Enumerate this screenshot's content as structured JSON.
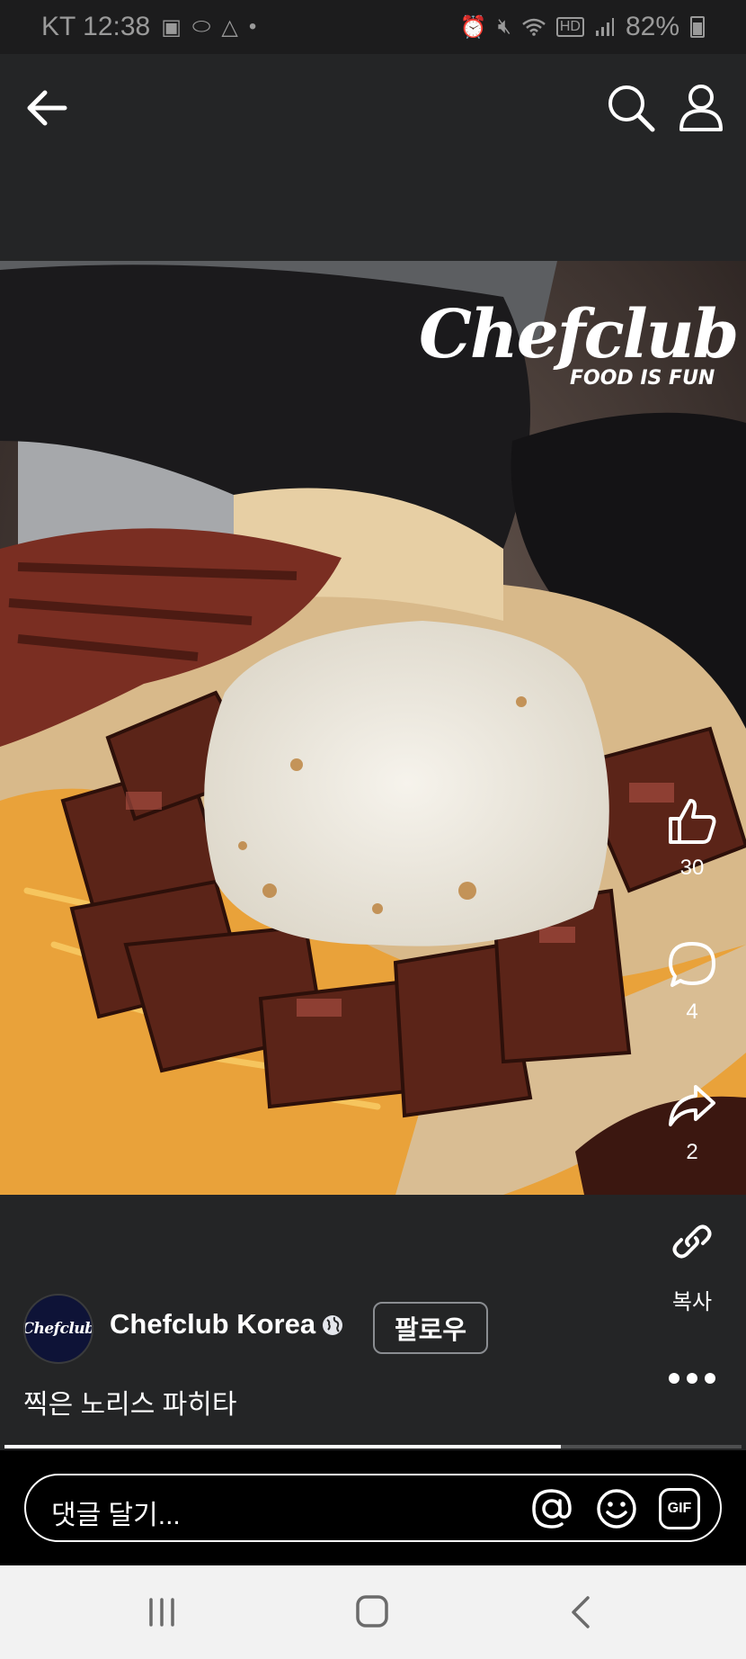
{
  "status_bar": {
    "carrier_time": "KT 12:38",
    "battery_percent": "82%",
    "left_icons": [
      "screenshot-icon",
      "pill-icon",
      "warning-icon",
      "dot-icon"
    ],
    "right_icons": [
      "alarm-icon",
      "mute-icon",
      "wifi-icon",
      "hd-icon",
      "signal-icon",
      "battery-icon"
    ]
  },
  "app_bar": {
    "back_icon": "back-arrow-icon",
    "search_icon": "search-icon",
    "profile_icon": "profile-icon"
  },
  "video": {
    "watermark_brand": "Chefclub",
    "watermark_tagline": "FOOD IS FUN",
    "progress": 0.755
  },
  "actions": {
    "like_count": "30",
    "comment_count": "4",
    "share_count": "2",
    "copy_label": "복사"
  },
  "post": {
    "avatar_text": "Chefclub",
    "page_name": "Chefclub Korea",
    "follow_label": "팔로우",
    "caption": "찍은 노리스 파히타"
  },
  "comment_bar": {
    "placeholder": "댓글 달기...",
    "gif_label": "GIF"
  },
  "colors": {
    "background": "#242526",
    "comment_bar": "#000000",
    "nav_bar": "#f2f2f2"
  }
}
